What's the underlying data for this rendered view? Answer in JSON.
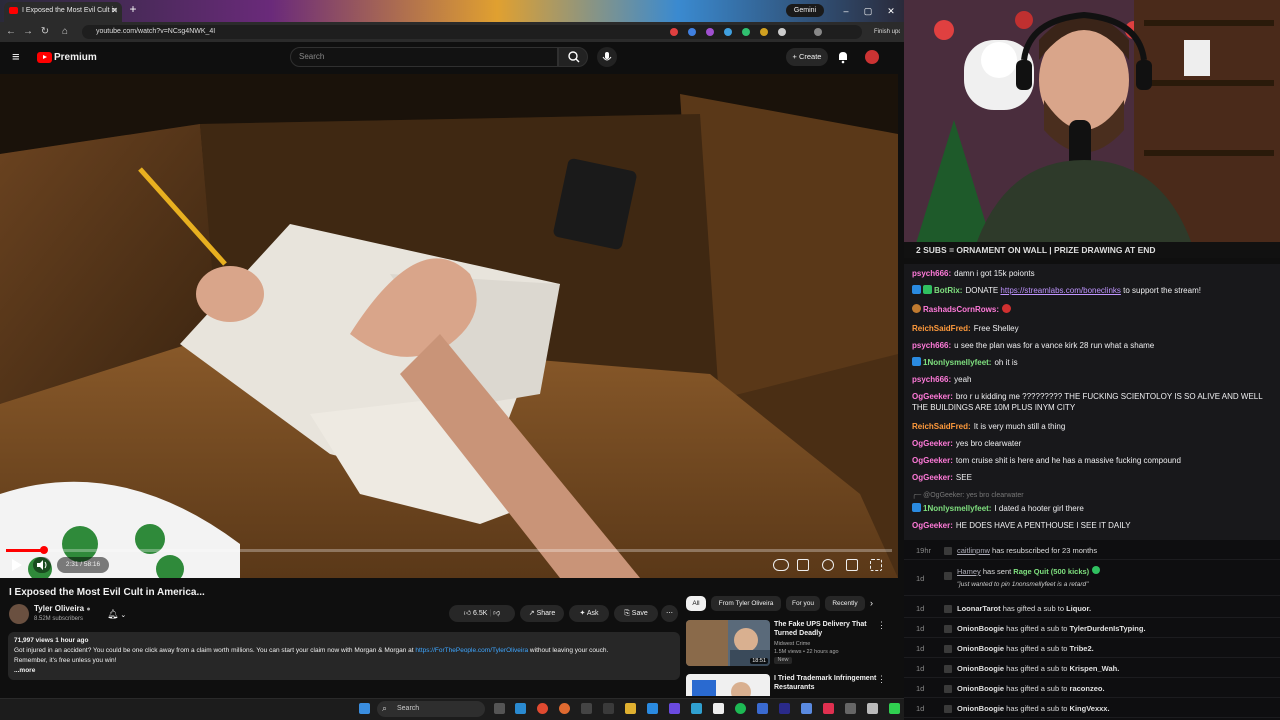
{
  "browser": {
    "tab_title": "I Exposed the Most Evil Cult in",
    "gemini_label": "Gemini",
    "url": "youtube.com/watch?v=NCsg4NWK_4I",
    "finish_update": "Finish update"
  },
  "youtube": {
    "brand": "Premium",
    "search_placeholder": "Search",
    "create_label": "Create"
  },
  "player": {
    "time": "2:31 / 58:16",
    "progress_fraction": 0.043
  },
  "video": {
    "title": "I Exposed the Most Evil Cult in America...",
    "channel": "Tyler Oliveira",
    "subscribers": "8.52M subscribers",
    "likes": "6.5K",
    "share_label": "Share",
    "ask_label": "Ask",
    "save_label": "Save",
    "views_line": "71,997 views  1 hour ago",
    "desc_text": "Got injured in an accident? You could be one click away from a claim worth millions. You can start your claim now with Morgan & Morgan at ",
    "desc_link": "https://ForThePeople.com/TylerOliveira",
    "desc_text2": " without leaving your couch.",
    "desc_line2": "Remember, it's free unless you win!",
    "desc_more": "...more"
  },
  "sidebar": {
    "chips": [
      "All",
      "From Tyler Oliveira",
      "For you",
      "Recently"
    ],
    "related": [
      {
        "title": "The Fake UPS Delivery That Turned Deadly",
        "channel": "Midwest Crime",
        "meta": "1.5M views • 22 hours ago",
        "badge": "New",
        "duration": "18:51"
      },
      {
        "title": "I Tried Trademark Infringement Restaurants",
        "channel": "",
        "meta": "",
        "badge": "",
        "duration": ""
      }
    ]
  },
  "stream": {
    "banner": "2 SUBS = ORNAMENT ON WALL | PRIZE DRAWING AT END"
  },
  "chat": [
    {
      "user": "psych666:",
      "color": "#ff7ad9",
      "text": "damn i got 15k poionts"
    },
    {
      "user": "BotRix:",
      "color": "#7fe07f",
      "text": "DONATE ",
      "link": "https://streamlabs.com/boneclinks",
      "text2": " to support the stream!"
    },
    {
      "user": "RashadsCornRows:",
      "color": "#ff7ad9",
      "text": ""
    },
    {
      "user": "ReichSaidFred:",
      "color": "#ff9a3c",
      "text": "Free Shelley"
    },
    {
      "user": "psych666:",
      "color": "#ff7ad9",
      "text": "u see the plan was for a vance kirk 28 run what a shame"
    },
    {
      "user": "1Nonlysmellyfeet:",
      "color": "#7fe07f",
      "text": "oh it is"
    },
    {
      "user": "psych666:",
      "color": "#ff7ad9",
      "text": "yeah"
    },
    {
      "user": "OgGeeker:",
      "color": "#ff7ad9",
      "text": "bro r u kidding me ????????? THE FUCKING SCIENTOLOY IS SO ALIVE AND WELL THE BUILDINGS ARE 10M PLUS INYM CITY"
    },
    {
      "user": "ReichSaidFred:",
      "color": "#ff9a3c",
      "text": "It is very much still a thing"
    },
    {
      "user": "OgGeeker:",
      "color": "#ff7ad9",
      "text": "yes bro clearwater"
    },
    {
      "user": "OgGeeker:",
      "color": "#ff7ad9",
      "text": "tom cruise shit is here and he has a massive fucking compound"
    },
    {
      "user": "OgGeeker:",
      "color": "#ff7ad9",
      "text": "SEE"
    },
    {
      "reply": "@OgGeeker: yes bro clearwater"
    },
    {
      "user": "1Nonlysmellyfeet:",
      "color": "#7fe07f",
      "text": "I dated a hooter girl there"
    },
    {
      "user": "OgGeeker:",
      "color": "#ff7ad9",
      "text": "HE DOES HAVE A PENTHOUSE I SEE IT DAILY"
    }
  ],
  "events": [
    {
      "time": "19hr",
      "name": "caitlinpnw",
      "text": " has resubscribed for 23 months",
      "bold": ""
    },
    {
      "time": "1d",
      "name": "Hamey",
      "text": " has sent ",
      "bold": "Rage Quit (500 kicks)",
      "note": "\"just wanted to pin 1nonsmellyfeet is a retard\""
    },
    {
      "time": "1d",
      "name": "LoonarTarot",
      "text": " has gifted a sub to ",
      "bold": "Liquor."
    },
    {
      "time": "1d",
      "name": "OnionBoogie",
      "text": " has gifted a sub to ",
      "bold": "TylerDurdenIsTyping."
    },
    {
      "time": "1d",
      "name": "OnionBoogie",
      "text": " has gifted a sub to ",
      "bold": "Tribe2."
    },
    {
      "time": "1d",
      "name": "OnionBoogie",
      "text": " has gifted a sub to ",
      "bold": "Krispen_Wah."
    },
    {
      "time": "1d",
      "name": "OnionBoogie",
      "text": " has gifted a sub to ",
      "bold": "raconzeo."
    },
    {
      "time": "1d",
      "name": "OnionBoogie",
      "text": " has gifted a sub to ",
      "bold": "KingVexxx."
    }
  ],
  "taskbar": {
    "search_placeholder": "Search"
  },
  "colors": {
    "accent": "#ff0000",
    "link": "#3ea6ff",
    "twitch_purple": "#bf94ff"
  }
}
